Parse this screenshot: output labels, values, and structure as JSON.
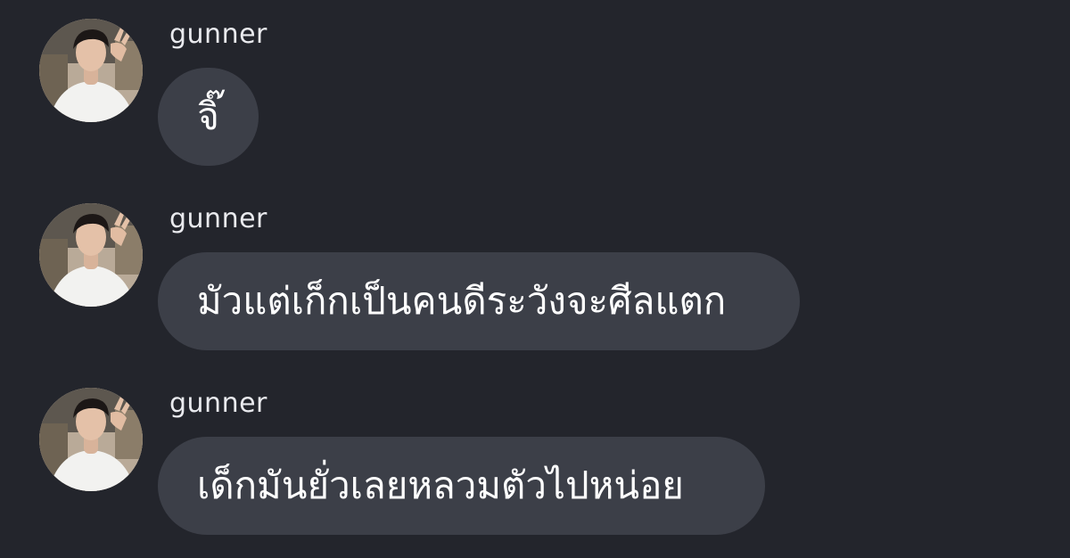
{
  "messages": [
    {
      "username": "gunner",
      "text": "จิ๊"
    },
    {
      "username": "gunner",
      "text": "มัวแต่เก็กเป็นคนดีระวังจะศีลแตก"
    },
    {
      "username": "gunner",
      "text": "เด็กมันยั่วเลยหลวมตัวไปหน่อย"
    }
  ],
  "colors": {
    "background": "#23252c",
    "bubble": "#3c3f48",
    "text": "#ffffff",
    "username": "#e9eaee"
  },
  "icons": {
    "avatar": "user-profile-photo"
  }
}
